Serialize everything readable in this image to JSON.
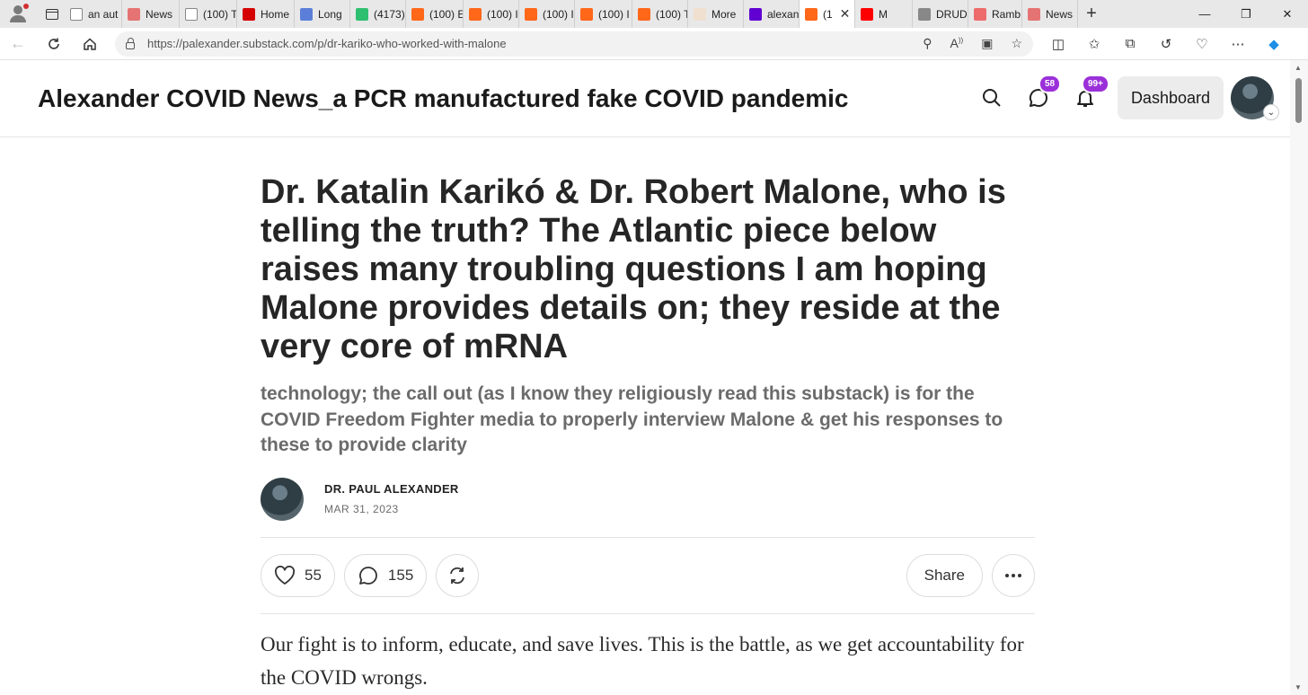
{
  "browser": {
    "tabs": [
      {
        "label": "an aut",
        "fav_color": "#ffffff",
        "fav_icon": "doc-icon"
      },
      {
        "label": "News",
        "fav_color": "#e57373",
        "fav_icon": "r-icon"
      },
      {
        "label": "(100) T",
        "fav_color": "#ffffff",
        "fav_icon": "doc-icon"
      },
      {
        "label": "Home",
        "fav_color": "#d50000",
        "fav_icon": "home-icon"
      },
      {
        "label": "Long",
        "fav_color": "#5b7fd9",
        "fav_icon": "s-icon"
      },
      {
        "label": "(4173)",
        "fav_color": "#2fbf71",
        "fav_icon": "g-icon"
      },
      {
        "label": "(100) E",
        "fav_color": "#ff6719",
        "fav_icon": "substack-icon"
      },
      {
        "label": "(100) I",
        "fav_color": "#ff6719",
        "fav_icon": "substack-icon"
      },
      {
        "label": "(100) I",
        "fav_color": "#ff6719",
        "fav_icon": "substack-icon"
      },
      {
        "label": "(100) I",
        "fav_color": "#ff6719",
        "fav_icon": "substack-icon"
      },
      {
        "label": "(100) T",
        "fav_color": "#ff6719",
        "fav_icon": "substack-icon"
      },
      {
        "label": "More",
        "fav_color": "#f0e0d0",
        "fav_icon": "b-icon"
      },
      {
        "label": "alexan",
        "fav_color": "#6001d2",
        "fav_icon": "yahoo-icon"
      },
      {
        "label": "(1",
        "fav_color": "#ff6719",
        "fav_icon": "substack-icon",
        "active": true
      },
      {
        "label": "M",
        "fav_color": "#ff0000",
        "fav_icon": "youtube-icon"
      },
      {
        "label": "DRUD",
        "fav_color": "#888888",
        "fav_icon": "drudge-icon"
      },
      {
        "label": "Ramb",
        "fav_color": "#ee6b6b",
        "fav_icon": "rumble-icon"
      },
      {
        "label": "News",
        "fav_color": "#e57373",
        "fav_icon": "r-icon"
      }
    ],
    "url": "https://palexander.substack.com/p/dr-kariko-who-worked-with-malone"
  },
  "header": {
    "site_title": "Alexander COVID News_a PCR manufactured fake COVID pandemic",
    "messages_badge": "58",
    "notifications_badge": "99+",
    "dashboard_label": "Dashboard",
    "badge_color": "#9b30d9"
  },
  "article": {
    "title": "Dr. Katalin Karikó & Dr. Robert Malone, who is telling the truth? The Atlantic piece below raises many troubling questions I am hoping Malone provides details on; they reside at the very core of mRNA",
    "subtitle": "technology; the call out (as I know they religiously read this substack) is for the COVID Freedom Fighter media to properly interview Malone & get his responses to these to provide clarity",
    "author": "DR. PAUL ALEXANDER",
    "date": "MAR 31, 2023",
    "likes": "55",
    "comments": "155",
    "share_label": "Share",
    "body": "Our fight is to inform, educate, and save lives. This is the battle, as we get accountability for the COVID wrongs."
  }
}
